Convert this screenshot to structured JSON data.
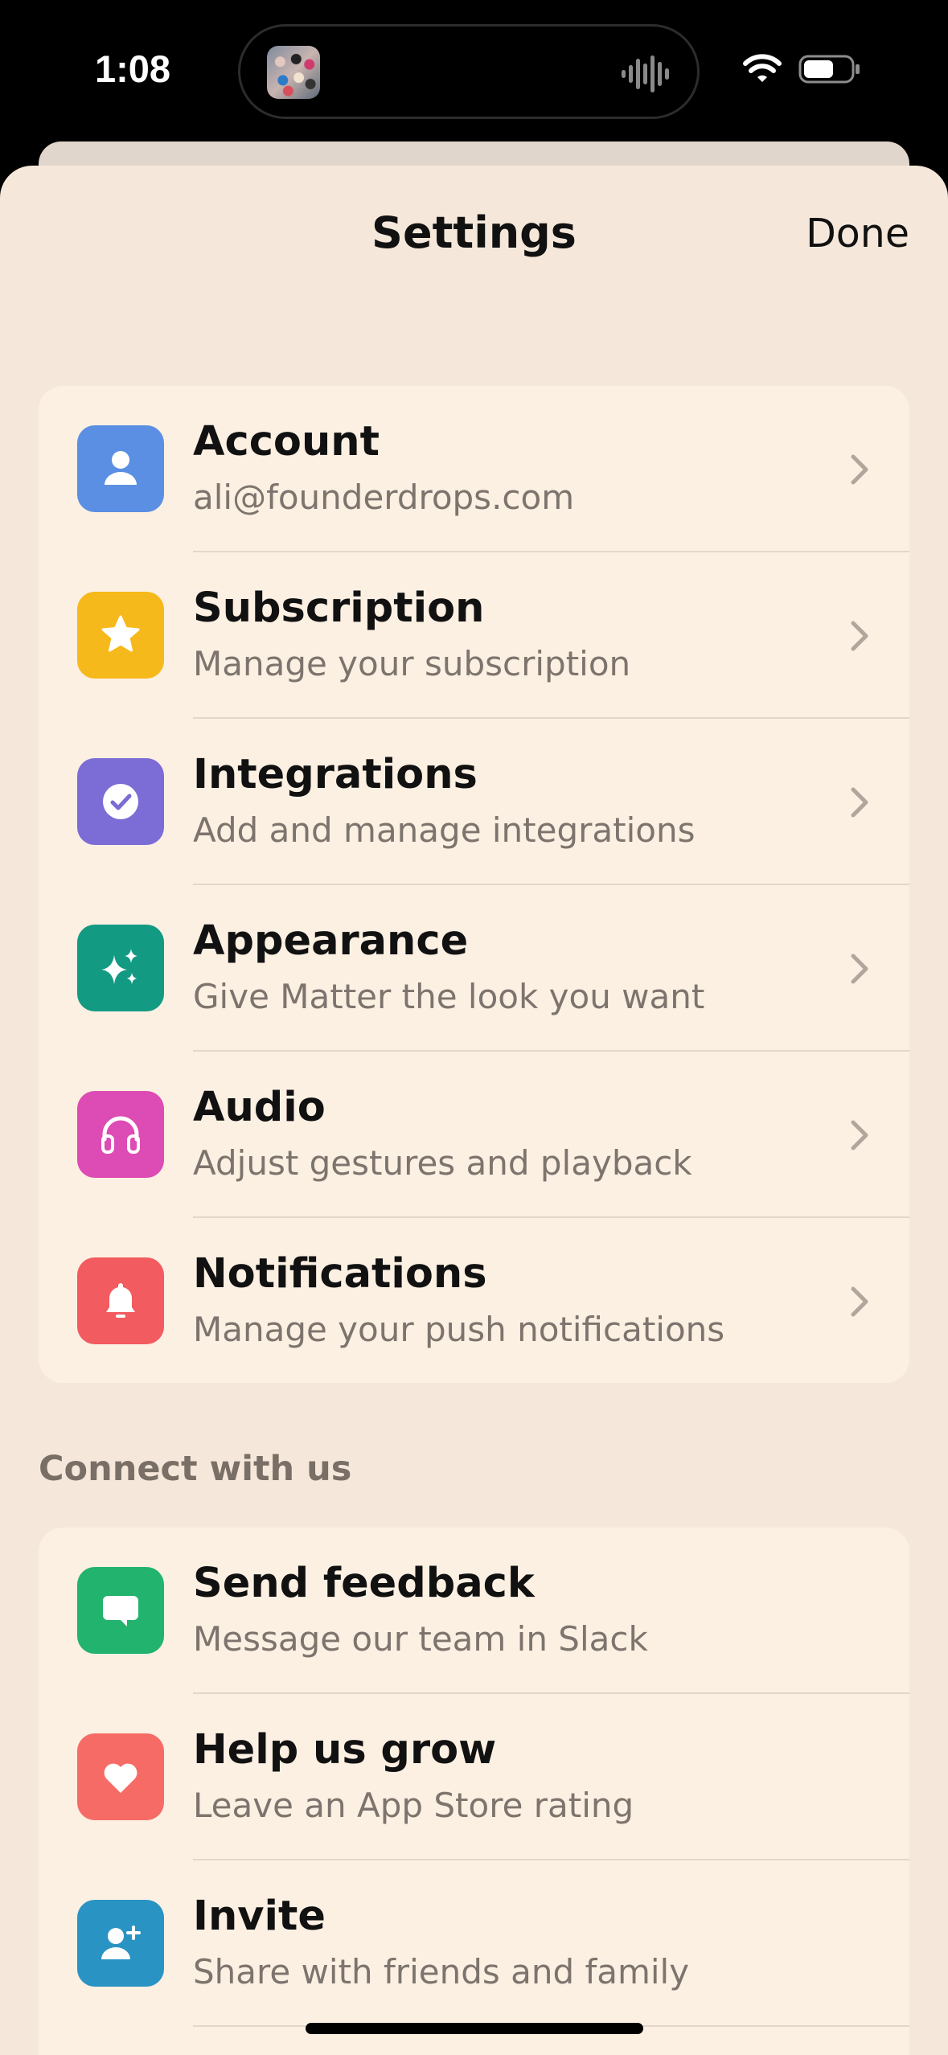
{
  "status_bar": {
    "time": "1:08"
  },
  "header": {
    "title": "Settings",
    "done_label": "Done"
  },
  "settings_items": [
    {
      "title": "Account",
      "subtitle": "ali@founderdrops.com",
      "icon": "person-icon",
      "color": "#5b8fe3"
    },
    {
      "title": "Subscription",
      "subtitle": "Manage your subscription",
      "icon": "star-icon",
      "color": "#f6b91c"
    },
    {
      "title": "Integrations",
      "subtitle": "Add and manage integrations",
      "icon": "check-circle-icon",
      "color": "#7b6cd6"
    },
    {
      "title": "Appearance",
      "subtitle": "Give Matter the look you want",
      "icon": "sparkles-icon",
      "color": "#139a83"
    },
    {
      "title": "Audio",
      "subtitle": "Adjust gestures and playback",
      "icon": "headphones-icon",
      "color": "#dd4bb4"
    },
    {
      "title": "Notifications",
      "subtitle": "Manage your push notifications",
      "icon": "bell-icon",
      "color": "#f25b5f"
    }
  ],
  "connect_section": {
    "header": "Connect with us",
    "items": [
      {
        "title": "Send feedback",
        "subtitle": "Message our team in Slack",
        "icon": "chat-bubble-icon",
        "color": "#22b36e"
      },
      {
        "title": "Help us grow",
        "subtitle": "Leave an App Store rating",
        "icon": "heart-icon",
        "color": "#f76b67"
      },
      {
        "title": "Invite",
        "subtitle": "Share with friends and family",
        "icon": "person-add-icon",
        "color": "#2994c4"
      }
    ]
  }
}
